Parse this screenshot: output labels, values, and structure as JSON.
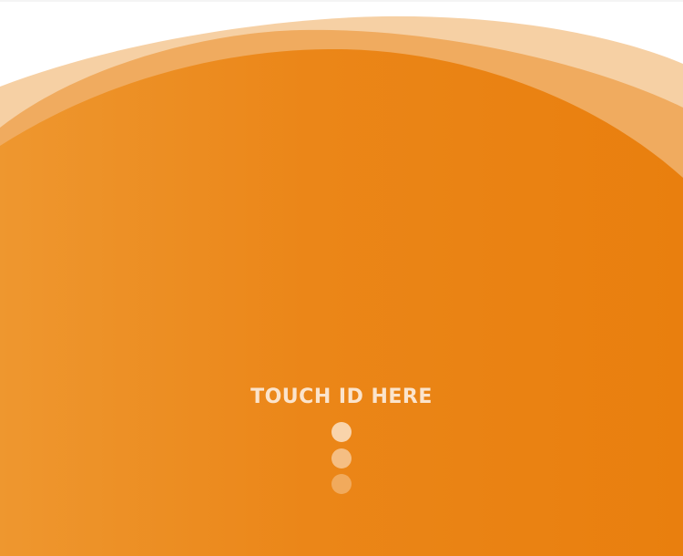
{
  "prompt": {
    "text": "TOUCH ID HERE"
  },
  "indicator": {
    "dot_count": 3
  },
  "colors": {
    "primary_orange": "#ea810f",
    "left_gradient": "#ee972f",
    "wave_light": "#f4c894",
    "text": "#fbe4cc",
    "dot": "#fbe2c6"
  }
}
